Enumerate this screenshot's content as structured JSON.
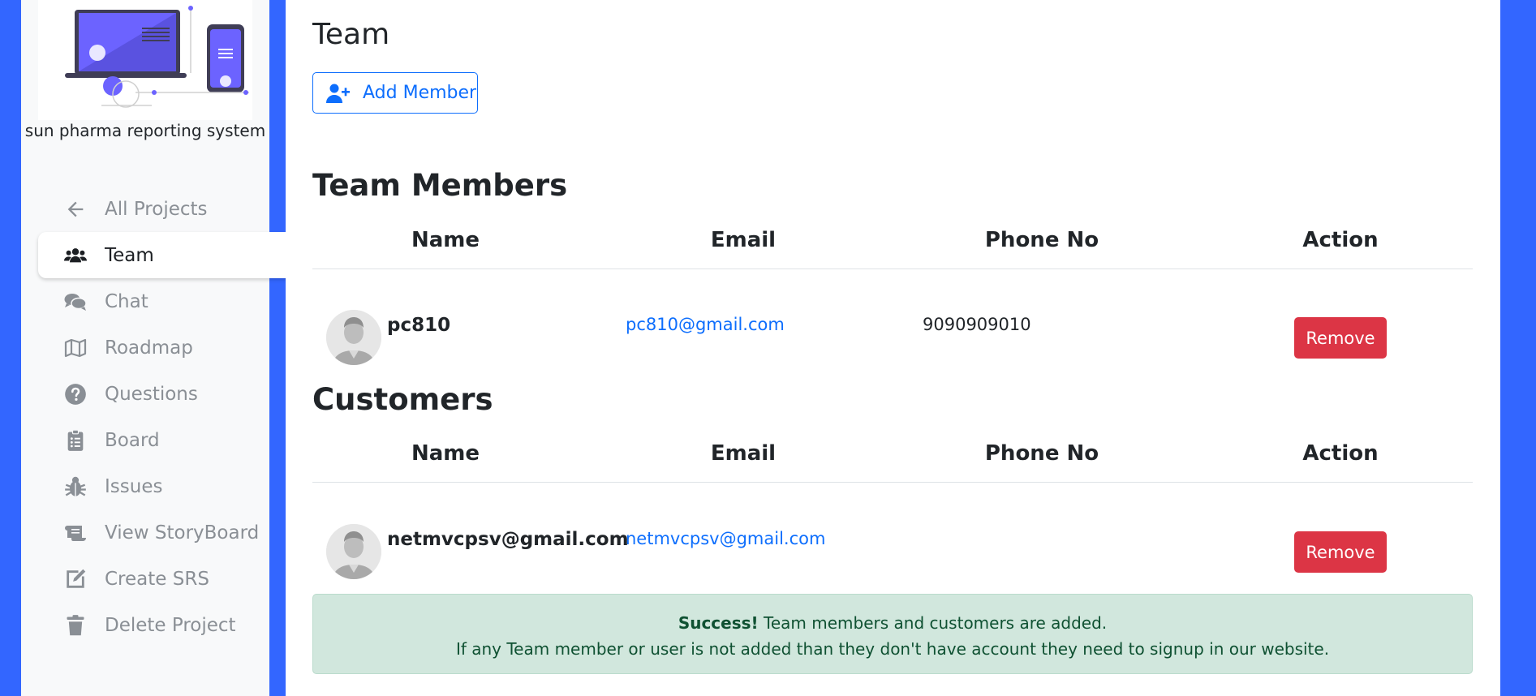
{
  "sidebar": {
    "project_name": "sun pharma reporting system",
    "items": [
      {
        "label": "All Projects",
        "icon": "arrow-left-icon"
      },
      {
        "label": "Team",
        "icon": "users-icon",
        "active": true
      },
      {
        "label": "Chat",
        "icon": "comments-icon"
      },
      {
        "label": "Roadmap",
        "icon": "map-icon"
      },
      {
        "label": "Questions",
        "icon": "question-circle-icon"
      },
      {
        "label": "Board",
        "icon": "clipboard-list-icon"
      },
      {
        "label": "Issues",
        "icon": "bug-icon"
      },
      {
        "label": "View StoryBoard",
        "icon": "scroll-icon"
      },
      {
        "label": "Create SRS",
        "icon": "edit-icon"
      },
      {
        "label": "Delete Project",
        "icon": "trash-icon"
      }
    ]
  },
  "main": {
    "title": "Team",
    "add_member_label": "Add Member",
    "team_section": {
      "title": "Team Members",
      "columns": [
        "Name",
        "Email",
        "Phone No",
        "Action"
      ],
      "rows": [
        {
          "name": "pc810",
          "email": "pc810@gmail.com",
          "phone": "9090909010",
          "action": "Remove"
        }
      ]
    },
    "customers_section": {
      "title": "Customers",
      "columns": [
        "Name",
        "Email",
        "Phone No",
        "Action"
      ],
      "rows": [
        {
          "name": "netmvcpsv@gmail.com",
          "email": "netmvcpsv@gmail.com",
          "phone": "",
          "action": "Remove"
        }
      ]
    },
    "alert": {
      "strong": "Success!",
      "line1": "Team members and customers are added.",
      "line2": "If any Team member or user is not added than they don't have account they need to signup in our website."
    }
  },
  "colors": {
    "background": "#3366ff",
    "primary": "#0d6efd",
    "danger": "#dc3545",
    "success_bg": "#d1e7dd",
    "illustration": "#6c63ff"
  }
}
